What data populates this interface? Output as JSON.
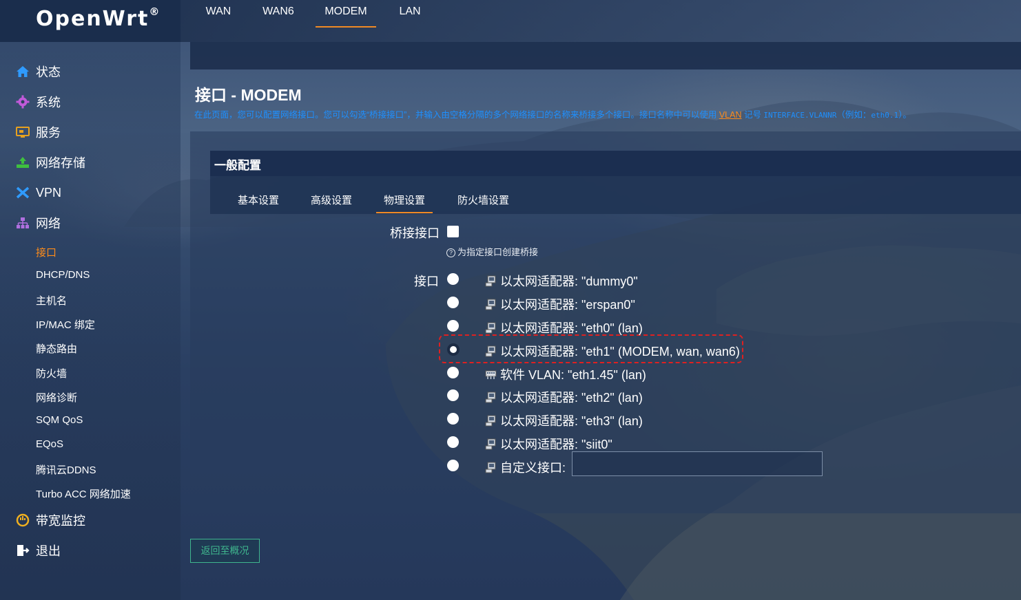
{
  "brand": {
    "name": "OpenWrt",
    "mark": "®"
  },
  "sidebar": {
    "main_top": [
      {
        "label": "状态",
        "icon": "home-icon"
      },
      {
        "label": "系统",
        "icon": "gear-icon"
      },
      {
        "label": "服务",
        "icon": "services-icon"
      },
      {
        "label": "网络存储",
        "icon": "storage-icon"
      },
      {
        "label": "VPN",
        "icon": "vpn-icon"
      },
      {
        "label": "网络",
        "icon": "network-icon"
      }
    ],
    "sub": [
      {
        "label": "接口",
        "active": true
      },
      {
        "label": "DHCP/DNS"
      },
      {
        "label": "主机名"
      },
      {
        "label": "IP/MAC 绑定"
      },
      {
        "label": "静态路由"
      },
      {
        "label": "防火墙"
      },
      {
        "label": "网络诊断"
      },
      {
        "label": "SQM QoS"
      },
      {
        "label": "EQoS"
      },
      {
        "label": "腾讯云DDNS"
      },
      {
        "label": "Turbo ACC 网络加速"
      }
    ],
    "main_bottom": [
      {
        "label": "带宽监控",
        "icon": "bandwidth-icon"
      },
      {
        "label": "退出",
        "icon": "logout-icon"
      }
    ]
  },
  "tabs": [
    {
      "label": "WAN"
    },
    {
      "label": "WAN6"
    },
    {
      "label": "MODEM",
      "active": true
    },
    {
      "label": "LAN"
    }
  ],
  "page": {
    "title": "接口 - MODEM",
    "desc_before": "在此页面，您可以配置网络接口。您可以勾选“桥接接口”，并输入由空格分隔的多个网络接口的名称来桥接多个接口。接口名称中可以使用 ",
    "desc_link": "VLAN",
    "desc_mid": " 记号 ",
    "desc_code1": "INTERFACE.VLANNR",
    "desc_paren": "（例如：",
    "desc_code2": "eth0.1",
    "desc_end": "）。"
  },
  "section": {
    "title": "一般配置",
    "subtabs": [
      {
        "label": "基本设置"
      },
      {
        "label": "高级设置"
      },
      {
        "label": "物理设置",
        "active": true
      },
      {
        "label": "防火墙设置"
      }
    ]
  },
  "form": {
    "bridge_label": "桥接接口",
    "bridge_checked": false,
    "bridge_hint": "为指定接口创建桥接",
    "iface_label": "接口",
    "interfaces": [
      {
        "text": "以太网适配器: \"dummy0\"",
        "checked": false,
        "icon": "ethernet-adapter-icon"
      },
      {
        "text": "以太网适配器: \"erspan0\"",
        "checked": false,
        "icon": "ethernet-adapter-icon"
      },
      {
        "text": "以太网适配器: \"eth0\" (lan)",
        "checked": false,
        "icon": "ethernet-adapter-icon"
      },
      {
        "text": "以太网适配器: \"eth1\" (MODEM, wan, wan6)",
        "checked": true,
        "icon": "ethernet-adapter-icon"
      },
      {
        "text": "软件 VLAN: \"eth1.45\" (lan)",
        "checked": false,
        "icon": "vlan-icon"
      },
      {
        "text": "以太网适配器: \"eth2\" (lan)",
        "checked": false,
        "icon": "ethernet-adapter-icon"
      },
      {
        "text": "以太网适配器: \"eth3\" (lan)",
        "checked": false,
        "icon": "ethernet-adapter-icon"
      },
      {
        "text": "以太网适配器: \"siit0\"",
        "checked": false,
        "icon": "ethernet-adapter-icon"
      }
    ],
    "custom_label": "自定义接口:",
    "custom_value": ""
  },
  "buttons": {
    "back": "返回至概况"
  },
  "colors": {
    "accent": "#f08a24",
    "link": "#1e90ff",
    "active_sub": "#ff8c1a",
    "highlight": "#e02020",
    "back_btn": "#3fb68e"
  }
}
